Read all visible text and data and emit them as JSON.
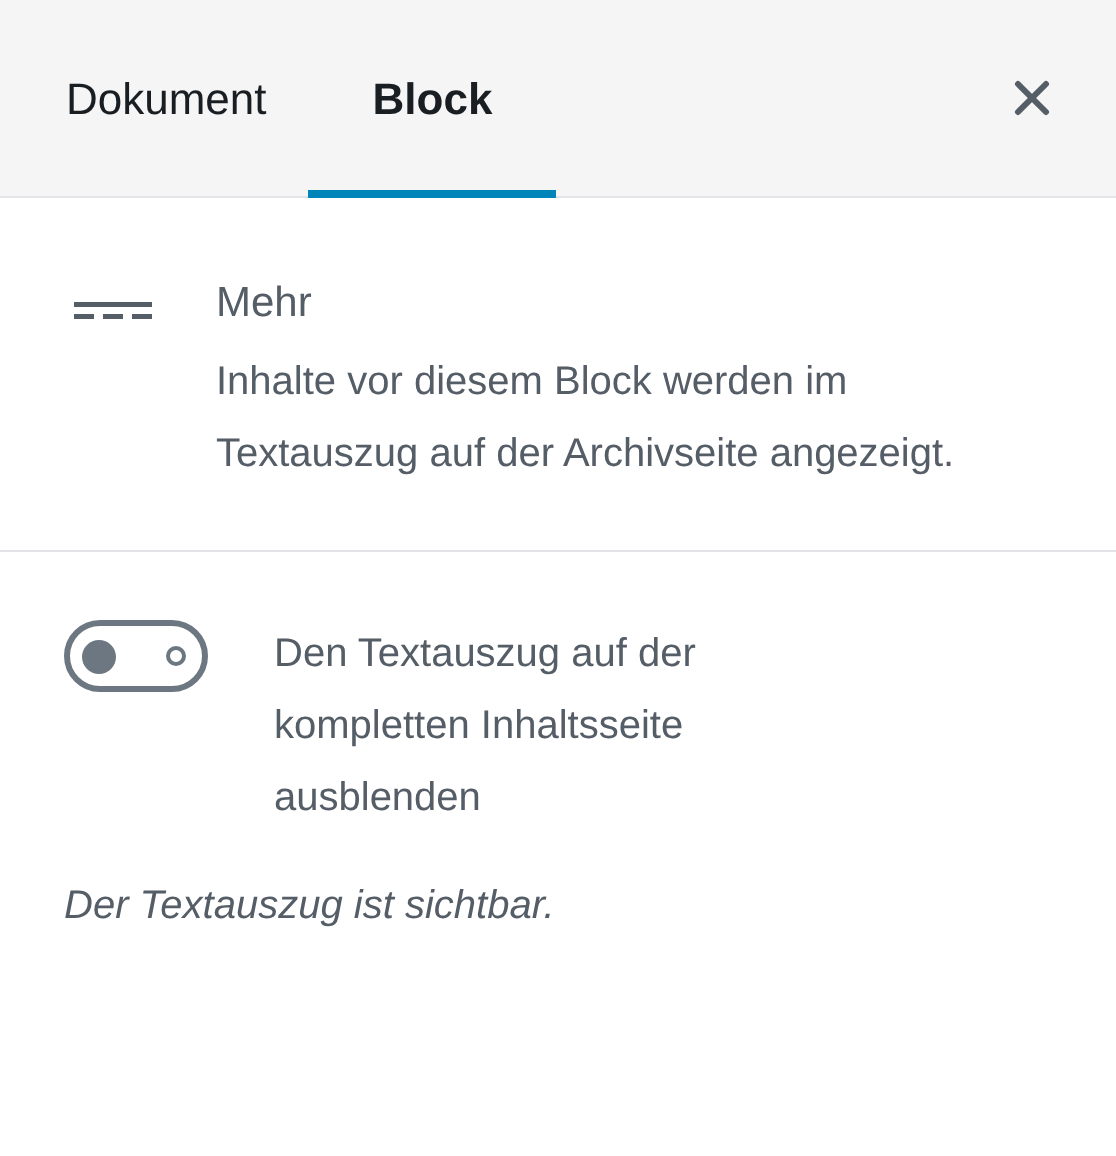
{
  "tabs": [
    {
      "label": "Dokument",
      "selected": false
    },
    {
      "label": "Block",
      "selected": true
    }
  ],
  "block": {
    "title": "Mehr",
    "description": "Inhalte vor diesem Block werden im Textauszug auf der Archivseite angezeigt."
  },
  "setting": {
    "label": "Den Textauszug auf der kompletten Inhaltsseite ausblenden",
    "on": false,
    "help": "Der Textauszug ist sichtbar."
  }
}
